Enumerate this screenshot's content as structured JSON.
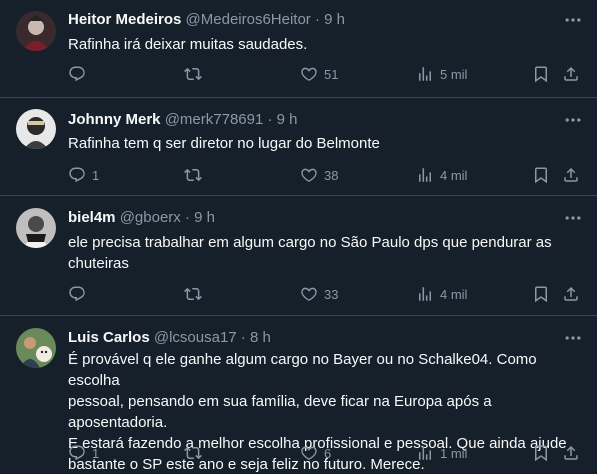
{
  "tweets": [
    {
      "name": "Heitor Medeiros",
      "handle": "@Medeiros6Heitor",
      "time": "9 h",
      "text": "Rafinha irá deixar muitas saudades.",
      "replies": "",
      "retweets": "",
      "likes": "51",
      "views": "5 mil"
    },
    {
      "name": "Johnny Merk",
      "handle": "@merk778691",
      "time": "9 h",
      "text": "Rafinha tem q ser diretor no lugar do Belmonte",
      "replies": "1",
      "retweets": "",
      "likes": "38",
      "views": "4 mil"
    },
    {
      "name": "biel4m",
      "handle": "@gboerx",
      "time": "9 h",
      "text": "ele precisa trabalhar em algum cargo no São Paulo dps que pendurar as\nchuteiras",
      "replies": "",
      "retweets": "",
      "likes": "33",
      "views": "4 mil"
    },
    {
      "name": "Luis Carlos",
      "handle": "@lcsousa17",
      "time": "8 h",
      "text": "É provável q ele ganhe algum cargo no Bayer ou no Schalke04. Como escolha\npessoal, pensando em sua família, deve ficar na Europa após a aposentadoria.\nE estará fazendo a melhor escolha profissional e pessoal. Que ainda ajude\nbastante o SP este ano e seja feliz no futuro. Merece.",
      "replies": "1",
      "retweets": "",
      "likes": "6",
      "views": "1 mil"
    }
  ],
  "separator": " · ",
  "colors": {
    "background": "#15202b",
    "text": "#f7f9f9",
    "secondary": "#8b98a5",
    "border": "#38444d"
  },
  "icons": [
    "more-icon",
    "reply-icon",
    "retweet-icon",
    "like-icon",
    "views-icon",
    "bookmark-icon",
    "share-icon"
  ]
}
